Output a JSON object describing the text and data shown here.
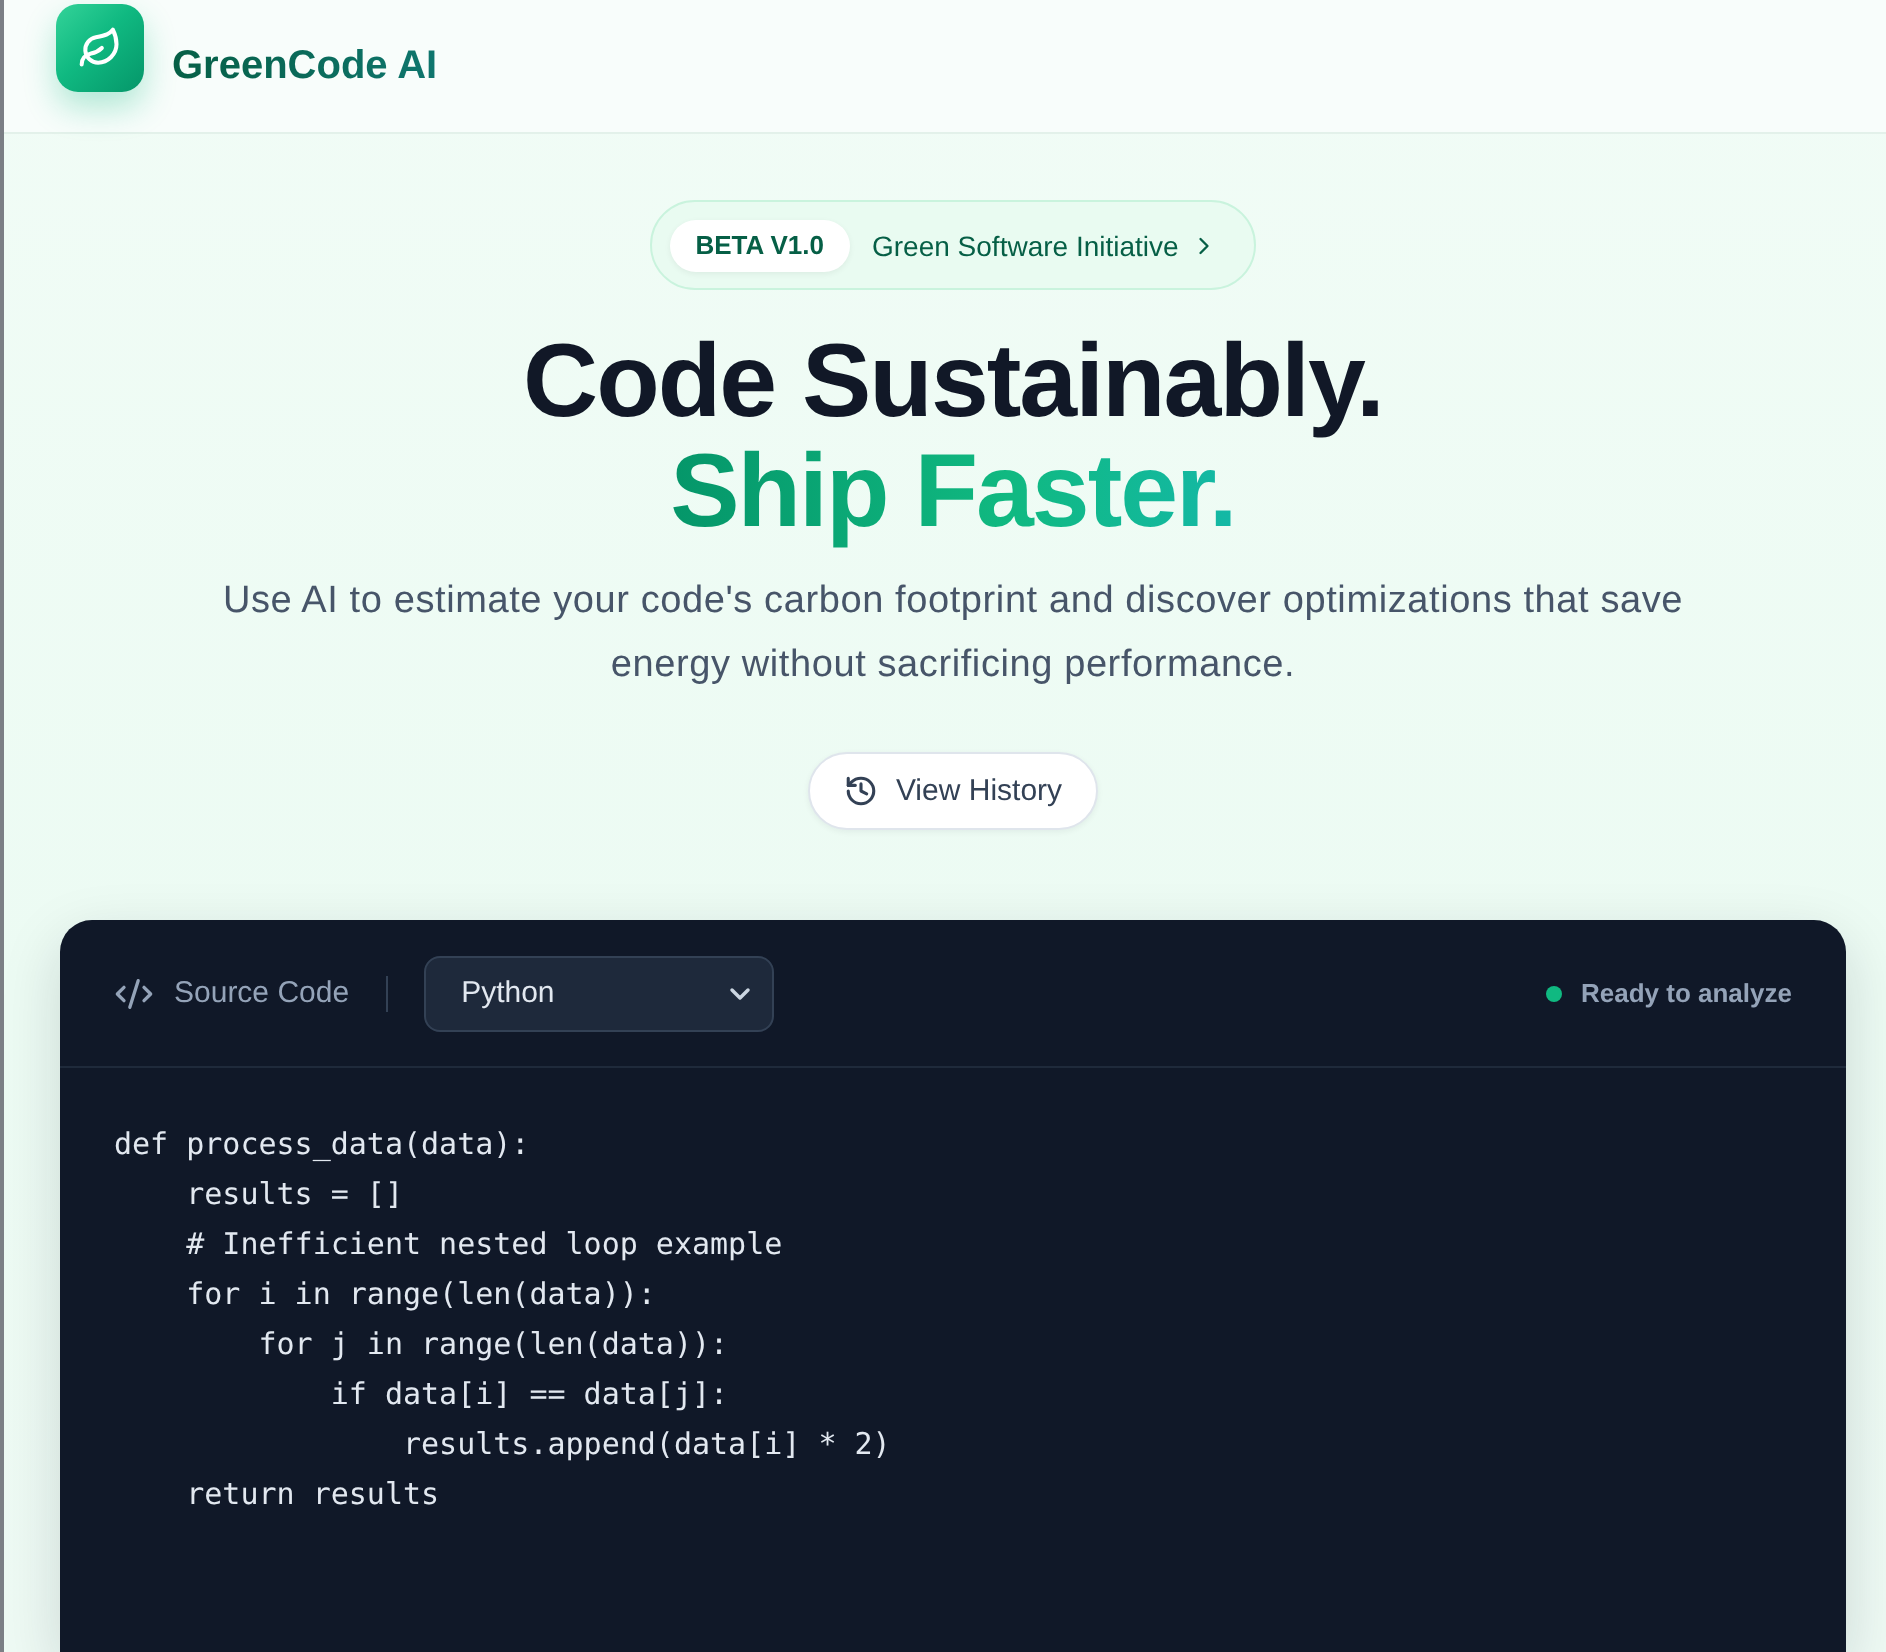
{
  "header": {
    "logo_text": "GreenCode AI"
  },
  "announcement": {
    "badge": "BETA V1.0",
    "label": "Green Software Initiative"
  },
  "hero": {
    "title_line_1": "Code Sustainably.",
    "title_line_2": "Ship Faster.",
    "description": "Use AI to estimate your code's carbon footprint and discover optimizations that save energy without sacrificing performance."
  },
  "history_button": {
    "label": "View History"
  },
  "editor": {
    "title": "Source Code",
    "language": "Python",
    "status": {
      "ready": true,
      "label": "Ready to analyze"
    },
    "code": [
      "def process_data(data):",
      "    results = []",
      "    # Inefficient nested loop example",
      "    for i in range(len(data)):",
      "        for j in range(len(data)):",
      "            if data[i] == data[j]:",
      "                results.append(data[i] * 2)",
      "    return results"
    ]
  }
}
